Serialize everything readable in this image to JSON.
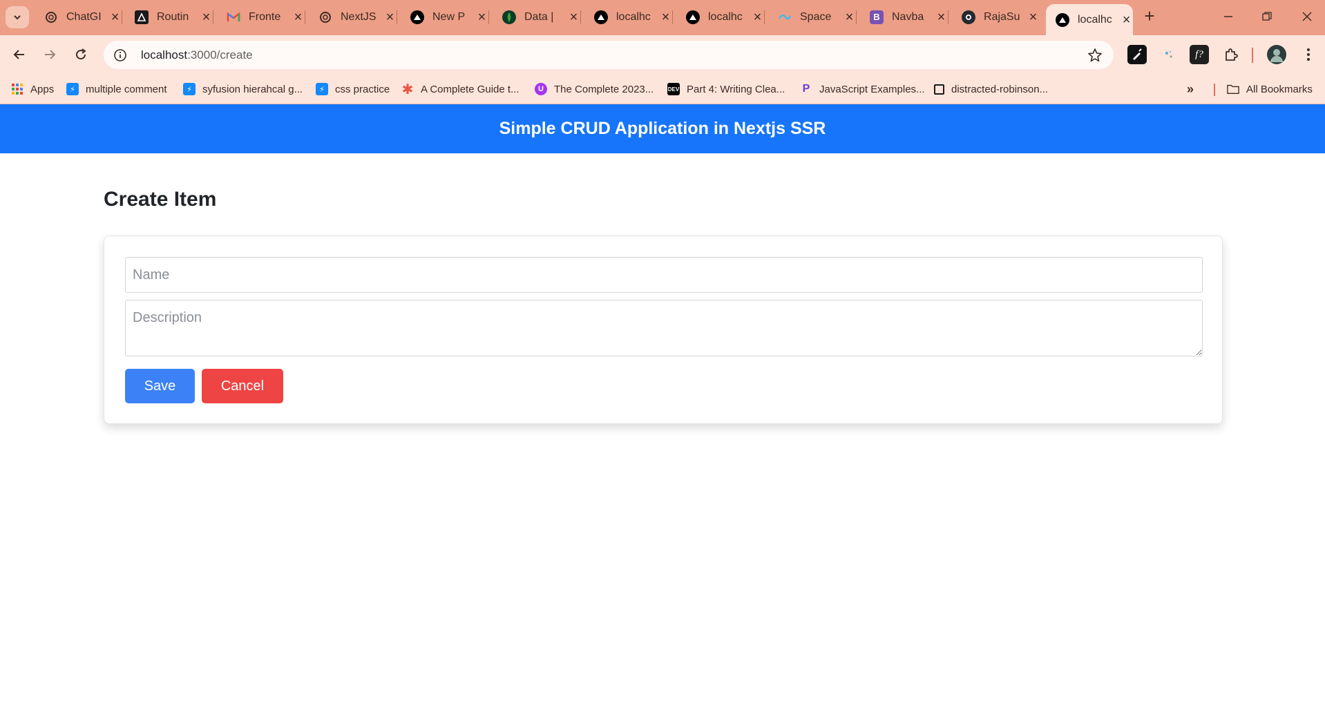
{
  "browser": {
    "tabs": [
      {
        "title": "ChatGI",
        "icon": "openai-icon"
      },
      {
        "title": "Routin",
        "icon": "angular-icon"
      },
      {
        "title": "Fronte",
        "icon": "gmail-icon"
      },
      {
        "title": "NextJS",
        "icon": "openai-icon"
      },
      {
        "title": "New P",
        "icon": "vercel-icon"
      },
      {
        "title": "Data |",
        "icon": "mongodb-icon"
      },
      {
        "title": "localhc",
        "icon": "vercel-icon"
      },
      {
        "title": "localhc",
        "icon": "vercel-icon"
      },
      {
        "title": "Space",
        "icon": "tailwind-icon"
      },
      {
        "title": "Navba",
        "icon": "bootstrap-icon"
      },
      {
        "title": "RajaSu",
        "icon": "github-icon"
      },
      {
        "title": "localhc",
        "icon": "vercel-icon",
        "active": true
      }
    ],
    "address": {
      "host": "localhost",
      "path": ":3000/create"
    },
    "bookmarks": [
      {
        "label": "Apps",
        "icon": "apps-grid-icon"
      },
      {
        "label": "multiple comment",
        "icon": "stackblitz-icon"
      },
      {
        "label": "syfusion hierahcal g...",
        "icon": "stackblitz-icon"
      },
      {
        "label": "css practice",
        "icon": "stackblitz-icon"
      },
      {
        "label": "A Complete Guide t...",
        "icon": "asterisk-icon"
      },
      {
        "label": "The Complete 2023...",
        "icon": "udemy-icon"
      },
      {
        "label": "Part 4: Writing Clea...",
        "icon": "dev-icon"
      },
      {
        "label": "JavaScript Examples...",
        "icon": "programiz-icon"
      },
      {
        "label": "distracted-robinson...",
        "icon": "codesandbox-icon"
      }
    ],
    "all_bookmarks_label": "All Bookmarks",
    "colors": {
      "tabstrip": "#ec9e86",
      "toolbar": "#fde5dc"
    }
  },
  "app": {
    "navbar_title": "Simple CRUD Application in Nextjs SSR",
    "page_title": "Create Item",
    "form": {
      "name_placeholder": "Name",
      "description_placeholder": "Description",
      "save_label": "Save",
      "cancel_label": "Cancel"
    },
    "colors": {
      "navbar": "#1775fb",
      "save": "#3c82f6",
      "cancel": "#ef4444"
    }
  }
}
